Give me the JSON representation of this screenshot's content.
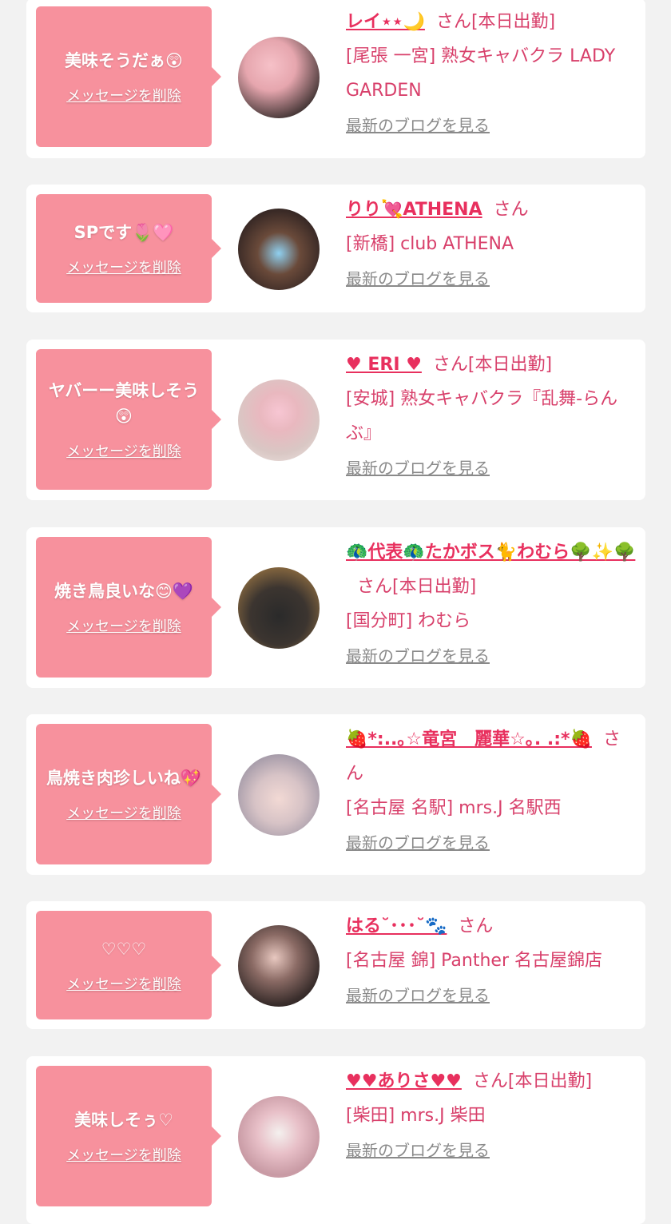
{
  "colors": {
    "bubble": "#f7919d",
    "name": "#e8305e",
    "shop": "#d8406b",
    "blog_link": "#8a8a8a",
    "page_bg": "#f2f2f2"
  },
  "delete_label": "メッセージを削除",
  "blog_label": "最新のブログを見る",
  "messages": [
    {
      "comment": "美味そうだぁ😲",
      "name": "レイ⋆⋆🌙",
      "suffix": "さん[本日出勤]",
      "shop": "[尾張 一宮] 熟女キャバクラ LADY GARDEN"
    },
    {
      "comment": "SPです🌷🩷",
      "name": "りり💘ATHENA",
      "suffix": "さん",
      "shop": "[新橋] club ATHENA"
    },
    {
      "comment": "ヤバーー美味しそう😲",
      "name": "♥ ERI ♥",
      "suffix": "さん[本日出勤]",
      "shop": "[安城] 熟女キャバクラ『乱舞-らんぶ』"
    },
    {
      "comment": "焼き鳥良いな😊💜",
      "name": "🦚代表🦚たかボス🐈わむら🌳✨🌳",
      "suffix": "さん[本日出勤]",
      "shop": "[国分町] わむら"
    },
    {
      "comment": "鳥焼き肉珍しいね💖",
      "name": "🍓*:..｡☆竜宮　麗華☆｡. .:*🍓",
      "suffix": "さん",
      "shop": "[名古屋 名駅] mrs.J 名駅西"
    },
    {
      "comment": "♡♡♡",
      "name": "はる˘･･･˘🐾",
      "suffix": "さん",
      "shop": "[名古屋 錦] Panther 名古屋錦店"
    },
    {
      "comment": "美味しそぅ♡",
      "name": "♥♥ありさ♥♥",
      "suffix": "さん[本日出勤]",
      "shop": "[柴田] mrs.J 柴田"
    }
  ]
}
